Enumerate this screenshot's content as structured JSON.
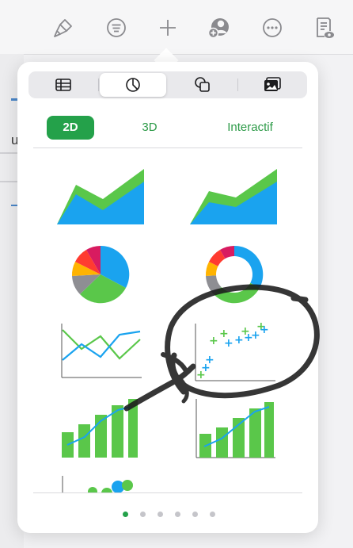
{
  "toolbar": {
    "buttons": [
      {
        "name": "brush-button",
        "icon": "paintbrush-icon"
      },
      {
        "name": "format-button",
        "icon": "text-lines-icon"
      },
      {
        "name": "insert-button",
        "icon": "plus-icon"
      },
      {
        "name": "collaborate-button",
        "icon": "add-person-icon"
      },
      {
        "name": "more-button",
        "icon": "ellipsis-icon"
      },
      {
        "name": "view-button",
        "icon": "document-eye-icon"
      }
    ]
  },
  "background": {
    "partial_text": "u"
  },
  "insert_popover": {
    "categories": [
      {
        "id": "table",
        "icon": "table-icon",
        "selected": false
      },
      {
        "id": "chart",
        "icon": "pie-chart-icon",
        "selected": true
      },
      {
        "id": "shape",
        "icon": "shapes-icon",
        "selected": false
      },
      {
        "id": "media",
        "icon": "photo-icon",
        "selected": false
      }
    ],
    "subtabs": [
      {
        "label": "2D",
        "selected": true
      },
      {
        "label": "3D",
        "selected": false
      },
      {
        "label": "Interactif",
        "selected": false
      }
    ],
    "chart_thumbnails": [
      "area-chart",
      "stacked-area-chart",
      "pie-chart",
      "donut-chart",
      "line-chart",
      "scatter-chart",
      "bar-line-chart",
      "bar-line-chart-framed",
      "bubble-chart"
    ],
    "pages": {
      "count": 6,
      "current": 1
    }
  },
  "colors": {
    "accent_green": "#24a14a",
    "chart_green": "#5ac74a",
    "chart_blue": "#1aa3ef"
  }
}
